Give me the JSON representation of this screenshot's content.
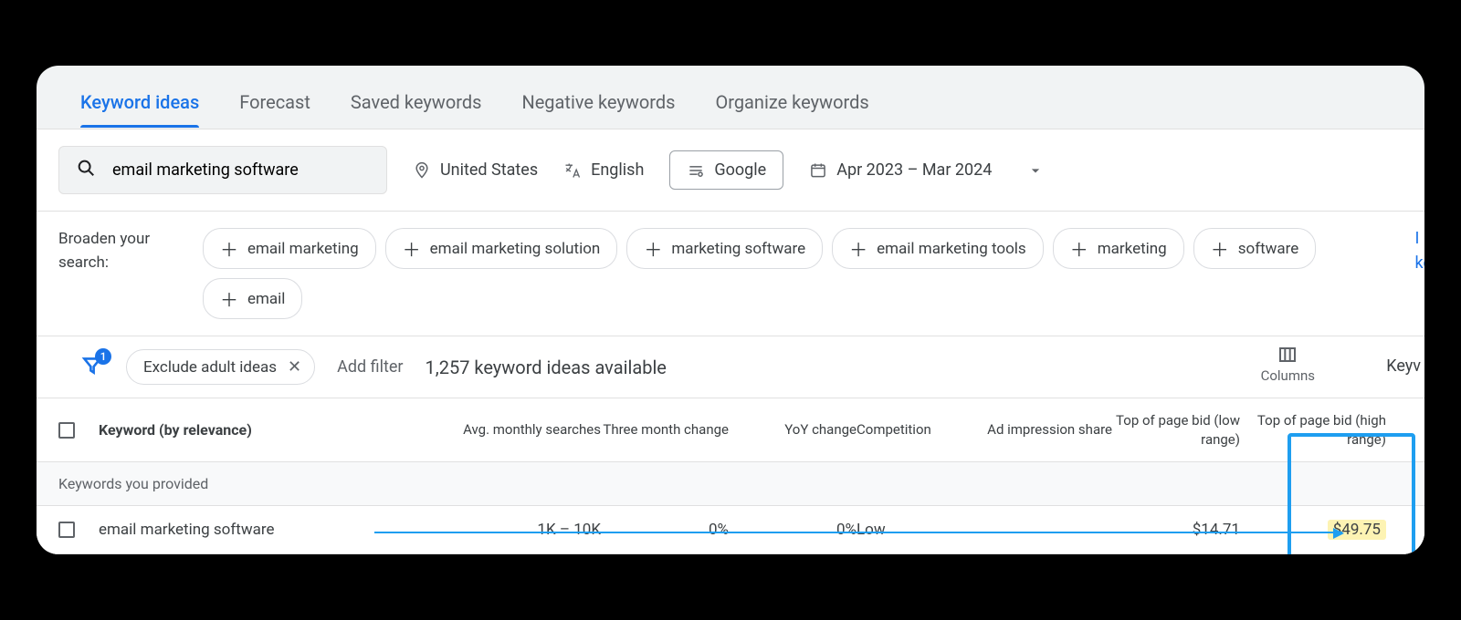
{
  "tabs": [
    {
      "label": "Keyword ideas",
      "active": true
    },
    {
      "label": "Forecast",
      "active": false
    },
    {
      "label": "Saved keywords",
      "active": false
    },
    {
      "label": "Negative keywords",
      "active": false
    },
    {
      "label": "Organize keywords",
      "active": false
    }
  ],
  "search": {
    "value": "email marketing software"
  },
  "filters": {
    "location": "United States",
    "language": "English",
    "network": "Google",
    "date_range": "Apr 2023 – Mar 2024"
  },
  "broaden": {
    "label": "Broaden your search:",
    "chips": [
      "email marketing",
      "email marketing solution",
      "marketing software",
      "email marketing tools",
      "marketing",
      "software",
      "email"
    ]
  },
  "side_link_partial": [
    "I",
    "ke"
  ],
  "filter_row": {
    "badge": "1",
    "applied_filter": "Exclude adult ideas",
    "add_filter": "Add filter",
    "available_text": "1,257 keyword ideas available",
    "columns_label": "Columns",
    "keyv_partial": "Keyv"
  },
  "columns": {
    "keyword": "Keyword (by relevance)",
    "avg": "Avg. monthly searches",
    "three_month": "Three month change",
    "yoy": "YoY change",
    "competition": "Competition",
    "ad_share": "Ad impression share",
    "bid_low": "Top of page bid (low range)",
    "bid_high": "Top of page bid (high range)"
  },
  "section_header": "Keywords you provided",
  "rows": [
    {
      "keyword": "email marketing software",
      "avg": "1K – 10K",
      "three_month": "0%",
      "yoy": "0%",
      "competition": "Low",
      "ad_share": "",
      "bid_low": "$14.71",
      "bid_high": "$49.75"
    }
  ]
}
